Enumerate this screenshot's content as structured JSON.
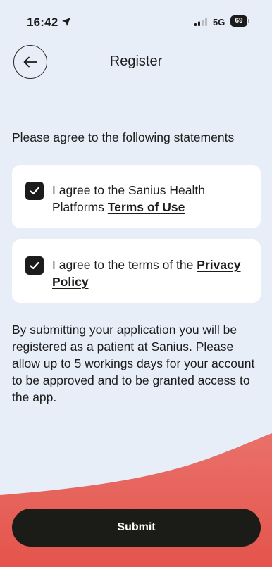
{
  "status_bar": {
    "time": "16:42",
    "network": "5G",
    "battery": "69",
    "icons": [
      "location-arrow-icon",
      "signal-icon",
      "battery-icon"
    ]
  },
  "header": {
    "title": "Register",
    "back_icon": "arrow-left-icon"
  },
  "main": {
    "instruction": "Please agree to the following statements",
    "statements": [
      {
        "text": "I agree to the Sanius Health Platforms ",
        "link": "Terms of Use",
        "checked": true
      },
      {
        "text": "I agree to the terms of the ",
        "link": "Privacy Policy",
        "checked": true
      }
    ],
    "info": "By submitting your application you will be registered as a patient at Sanius. Please allow up to 5 workings days for your account to be approved and to be granted access to the app."
  },
  "footer": {
    "submit_label": "Submit"
  },
  "colors": {
    "background": "#e8eef8",
    "card": "#ffffff",
    "accent_wave": "#e8615a",
    "button": "#1b1c18"
  }
}
